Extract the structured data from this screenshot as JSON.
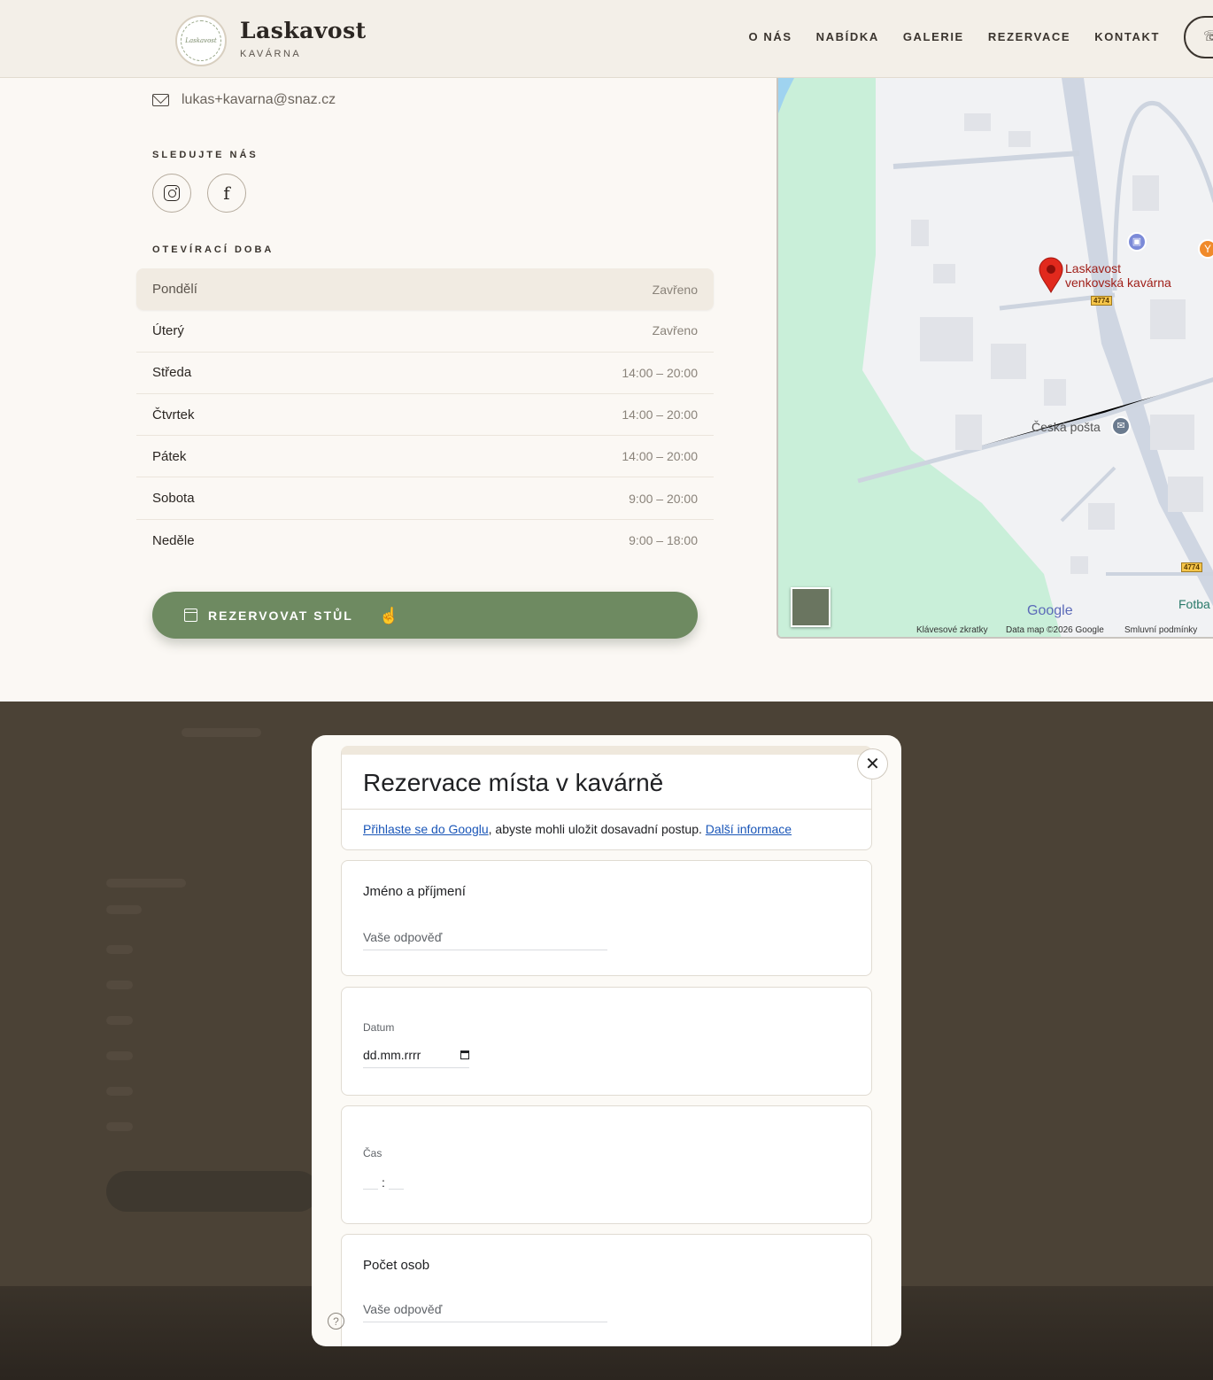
{
  "header": {
    "logo_text": "Laskavost",
    "brand_name": "Laskavost",
    "brand_sub": "KAVÁRNA",
    "nav": [
      "O NÁS",
      "NABÍDKA",
      "GALERIE",
      "REZERVACE",
      "KONTAKT"
    ]
  },
  "contact": {
    "email": "lukas+kavarna@snaz.cz",
    "follow_label": "SLEDUJTE NÁS",
    "hours_label": "OTEVÍRACÍ DOBA"
  },
  "hours": [
    {
      "day": "Pondělí",
      "time": "Zavřeno"
    },
    {
      "day": "Úterý",
      "time": "Zavřeno"
    },
    {
      "day": "Středa",
      "time": "14:00 – 20:00"
    },
    {
      "day": "Čtvrtek",
      "time": "14:00 – 20:00"
    },
    {
      "day": "Pátek",
      "time": "14:00 – 20:00"
    },
    {
      "day": "Sobota",
      "time": "9:00 – 20:00"
    },
    {
      "day": "Neděle",
      "time": "9:00 – 18:00"
    }
  ],
  "reserve_button": "REZERVOVAT STŮL",
  "map": {
    "place_line1": "Laskavost",
    "place_line2": "venkovská kavárna",
    "post_office": "Česká pošta",
    "fotba": "Fotba",
    "road_number": "4774",
    "google_logo": "Google",
    "footer_shortcuts": "Klávesové zkratky",
    "footer_data": "Data map ©2026 Google",
    "footer_terms": "Smluvní podmínky"
  },
  "form": {
    "title": "Rezervace místa v kavárně",
    "signin_link": "Přihlaste se do Googlu",
    "signin_text": ", abyste mohli uložit dosavadní postup. ",
    "more_info_link": "Další informace",
    "q_name": "Jméno a příjmení",
    "q_name_placeholder": "Vaše odpověď",
    "q_date": "Datum",
    "q_date_placeholder": "dd.mm.rrrr",
    "q_time": "Čas",
    "q_time_sep": ":",
    "q_people": "Počet osob",
    "q_people_placeholder": "Vaše odpověď"
  }
}
